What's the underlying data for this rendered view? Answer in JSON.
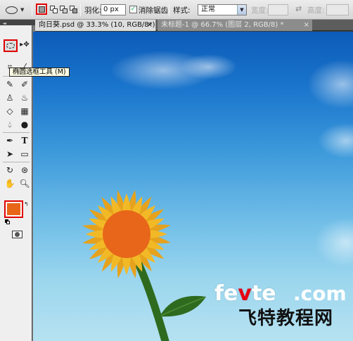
{
  "options_bar": {
    "feather_label": "羽化:",
    "feather_value": "0 px",
    "antialias_label": "消除锯齿",
    "antialias_checked": "✓",
    "style_label": "样式:",
    "style_value": "正常",
    "width_label": "宽度:",
    "height_label": "高度:"
  },
  "tabs": [
    {
      "label": "向日葵.psd @ 33.3% (10, RGB/8*) *",
      "close": "×",
      "active": true
    },
    {
      "label": "未标题-1 @ 66.7% (图层 2, RGB/8) *",
      "close": "×",
      "active": false
    }
  ],
  "toolbox": {
    "tooltip": "椭圆选框工具 (M)",
    "foreground_color": "#e8661a"
  },
  "watermark": {
    "brand_pre": "fe",
    "brand_accent": "v",
    "brand_post": "te",
    "domain": ".com",
    "chinese": "飞特教程网"
  },
  "colors": {
    "highlight": "#e00000",
    "sky_top": "#0c5bb8",
    "sky_bottom": "#b6e2f1",
    "petal": "#f0b423",
    "center": "#e8661a",
    "stem": "#2e6b1f"
  }
}
